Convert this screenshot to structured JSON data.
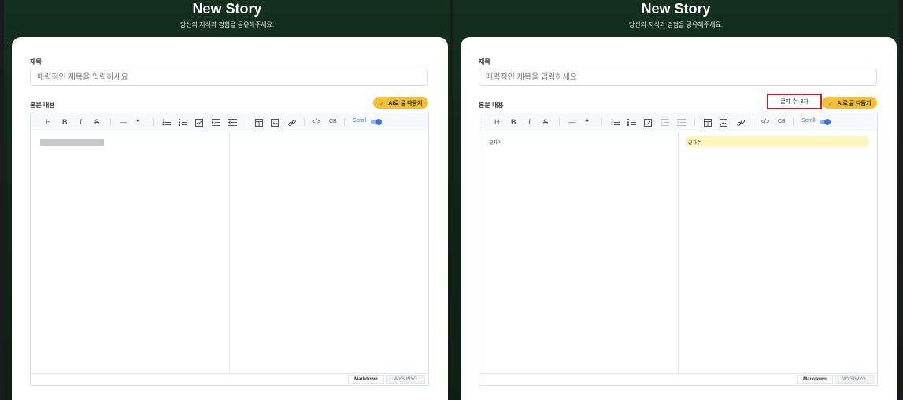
{
  "hero": {
    "title": "New Story",
    "subtitle": "당신의 지식과 경험을 공유해주세요."
  },
  "form": {
    "title_label": "제목",
    "title_placeholder": "매력적인 제목을 입력하세요",
    "body_label": "본문 내용",
    "ai_button_label": "AI로 글 다듬기"
  },
  "toolbar": {
    "heading": "H",
    "bold": "B",
    "italic": "I",
    "strike": "S",
    "hr": "—",
    "quote": "❝",
    "code": "</>",
    "codeblock": "CB",
    "scroll_label": "Scroll",
    "scroll_sync": true
  },
  "modes": {
    "markdown": "Markdown",
    "wysiwyg": "WYSIWYG"
  },
  "right_editor": {
    "char_count_label": "글자 수: 3자",
    "markdown_text": "글자어",
    "preview_text": "글자수"
  },
  "colors": {
    "accent": "#f3c034",
    "highlight": "#c8202a",
    "scroll": "#3d73d8",
    "hero_bg": "#12301d"
  }
}
